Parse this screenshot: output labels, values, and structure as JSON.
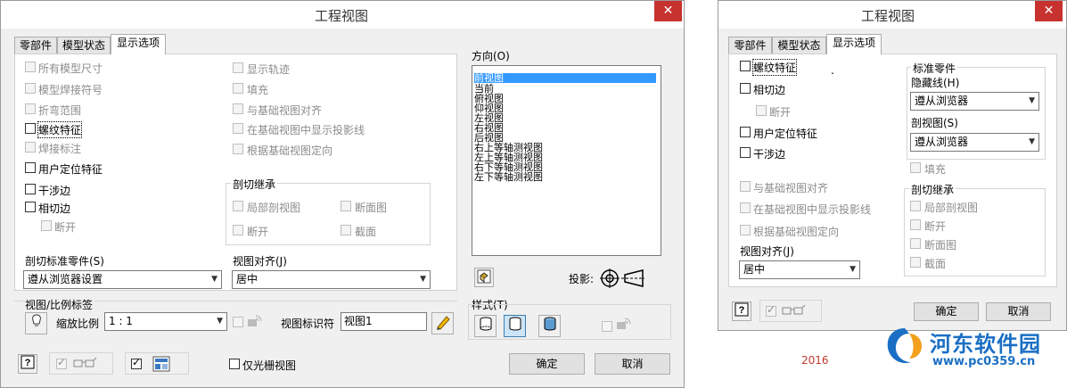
{
  "left_dialog": {
    "title": "工程视图",
    "close_label": "✕",
    "tabs": [
      "零部件",
      "模型状态",
      "显示选项"
    ],
    "options_col1": [
      {
        "label": "所有模型尺寸",
        "checked": false,
        "enabled": false
      },
      {
        "label": "模型焊接符号",
        "checked": false,
        "enabled": false
      },
      {
        "label": "折弯范围",
        "checked": false,
        "enabled": false
      },
      {
        "label": "螺纹特征",
        "checked": false,
        "enabled": true
      },
      {
        "label": "焊接标注",
        "checked": false,
        "enabled": false
      },
      {
        "label": "用户定位特征",
        "checked": false,
        "enabled": true
      },
      {
        "label": "干涉边",
        "checked": false,
        "enabled": true
      },
      {
        "label": "相切边",
        "checked": false,
        "enabled": true
      },
      {
        "label": "断开",
        "checked": false,
        "enabled": false
      }
    ],
    "options_col2": [
      {
        "label": "显示轨迹",
        "checked": false,
        "enabled": false
      },
      {
        "label": "填充",
        "checked": false,
        "enabled": false
      },
      {
        "label": "与基础视图对齐",
        "checked": false,
        "enabled": false
      },
      {
        "label": "在基础视图中显示投影线",
        "checked": false,
        "enabled": false
      },
      {
        "label": "根据基础视图定向",
        "checked": false,
        "enabled": false
      }
    ],
    "section_group": {
      "title": "剖切继承",
      "items": [
        "局部剖视图",
        "断面图",
        "断开",
        "截面"
      ]
    },
    "section_std_label": "剖切标准零件(S)",
    "section_std_value": "遵从浏览器设置",
    "view_align_label": "视图对齐(J)",
    "view_align_value": "居中",
    "orientation_label": "方向(O)",
    "orientation_items": [
      "前视图",
      "当前",
      "俯视图",
      "仰视图",
      "左视图",
      "右视图",
      "后视图",
      "右上等轴测视图",
      "左上等轴测视图",
      "右下等轴测视图",
      "左下等轴测视图"
    ],
    "orientation_selected": 0,
    "projection_label": "投影:",
    "view_scale_label": "视图/比例标签",
    "scale_label": "缩放比例",
    "scale_value": "1 : 1",
    "view_id_label": "视图标识符",
    "view_id_value": "视图1",
    "style_label": "样式(T)",
    "raster_only_label": "仅光栅视图",
    "ok_label": "确定",
    "cancel_label": "取消"
  },
  "right_dialog": {
    "title": "工程视图",
    "close_label": "✕",
    "tabs": [
      "零部件",
      "模型状态",
      "显示选项"
    ],
    "dot": ".",
    "options": [
      {
        "label": "螺纹特征",
        "enabled": true
      },
      {
        "label": "相切边",
        "enabled": true
      },
      {
        "label": "断开",
        "enabled": false
      },
      {
        "label": "用户定位特征",
        "enabled": true
      },
      {
        "label": "干涉边",
        "enabled": true
      },
      {
        "label": "与基础视图对齐",
        "enabled": false
      },
      {
        "label": "在基础视图中显示投影线",
        "enabled": false
      },
      {
        "label": "根据基础视图定向",
        "enabled": false
      }
    ],
    "std_parts_group": "标准零件",
    "hidden_line_label": "隐藏线(H)",
    "hidden_line_value": "遵从浏览器",
    "section_view_label": "剖视图(S)",
    "section_view_value": "遵从浏览器",
    "fill_label": "填充",
    "section_group": {
      "title": "剖切继承",
      "items": [
        "局部剖视图",
        "断开",
        "断面图",
        "截面"
      ]
    },
    "view_align_label": "视图对齐(J)",
    "view_align_value": "居中",
    "ok_label": "确定",
    "cancel_label": "取消"
  },
  "footer": {
    "year": "2016",
    "watermark_name": "河东软件园",
    "watermark_url": "www.pc0359.cn"
  },
  "colors": {
    "close_red": "#c7322f",
    "selection_blue": "#3399ff",
    "watermark_blue": "#1a6fc4",
    "year_red": "#c0392b"
  }
}
